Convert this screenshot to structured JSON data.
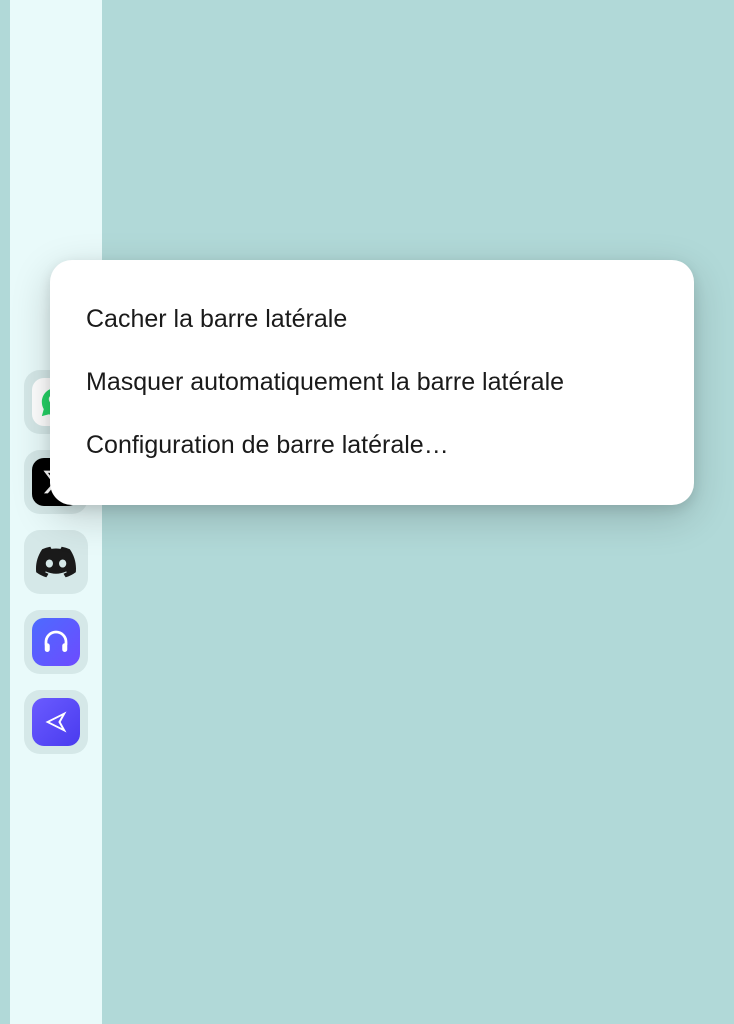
{
  "sidebar": {
    "items": [
      {
        "id": "whatsapp"
      },
      {
        "id": "x"
      },
      {
        "id": "discord"
      },
      {
        "id": "headphones"
      },
      {
        "id": "send"
      }
    ]
  },
  "context_menu": {
    "items": [
      {
        "label": "Cacher la barre latérale"
      },
      {
        "label": "Masquer automatiquement la barre latérale"
      },
      {
        "label": "Configuration de barre latérale…"
      }
    ]
  }
}
